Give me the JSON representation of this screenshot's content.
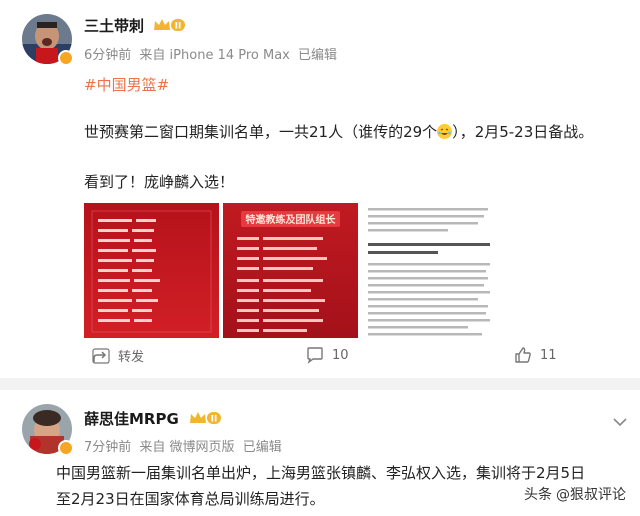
{
  "post1": {
    "author": "三土带刺",
    "level": "II",
    "time": "6分钟前",
    "source": "来自 iPhone 14 Pro Max",
    "edited": "已编辑",
    "hashtag": "#中国男篮#",
    "line1_a": "世预赛第二窗口期集训名单，一共21人（谁传的29个",
    "line1_b": "），2月5-23日备战。",
    "line2": "看到了！庞峥麟入选！",
    "actions": {
      "repost": "转发",
      "comments": "10",
      "likes": "11"
    },
    "image1_title": "",
    "image2_title": "特邀教练及团队组长",
    "image3_q": "Q：我们注意到本次集训名单中有一些新的年轻面孔，此次集训的选人标准是什么？"
  },
  "post2": {
    "author": "薛思佳MRPG",
    "level": "II",
    "time": "7分钟前",
    "source": "来自 微博网页版",
    "edited": "已编辑",
    "line1": "中国男篮新一届集训名单出炉，上海男篮张镇麟、李弘权入选，集训将于2月5日",
    "line2": "至2月23日在国家体育总局训练局进行。"
  },
  "watermark": {
    "prefix": "头条",
    "handle": "@狠叔评论"
  },
  "colors": {
    "hashtag": "#eb7350",
    "accent": "#f5a623",
    "poster_red": "#c8161d"
  }
}
